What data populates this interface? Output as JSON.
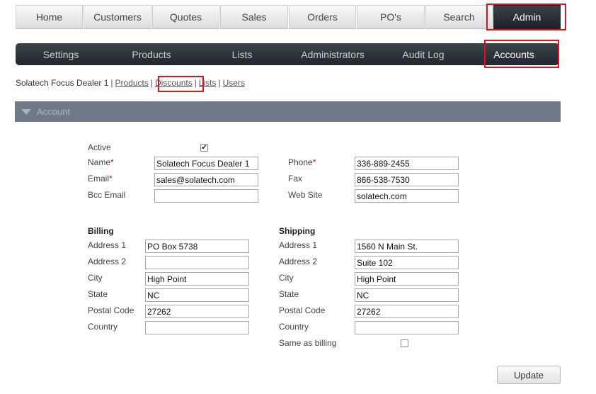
{
  "topnav": {
    "tabs": [
      "Home",
      "Customers",
      "Quotes",
      "Sales",
      "Orders",
      "PO's",
      "Search",
      "Admin"
    ],
    "active": "Admin"
  },
  "subnav": {
    "items": [
      "Settings",
      "Products",
      "Lists",
      "Administrators",
      "Audit Log",
      "Accounts"
    ],
    "active": "Accounts"
  },
  "breadcrumb": {
    "account": "Solatech Focus Dealer 1",
    "links": [
      "Products",
      "Discounts",
      "Lists",
      "Users"
    ],
    "separator": "|"
  },
  "section": {
    "title": "Account"
  },
  "form": {
    "active_label": "Active",
    "active_checked": true,
    "name_label": "Name",
    "name_value": "Solatech Focus Dealer 1",
    "email_label": "Email",
    "email_value": "sales@solatech.com",
    "bcc_label": "Bcc Email",
    "bcc_value": "",
    "phone_label": "Phone",
    "phone_value": "336-889-2455",
    "fax_label": "Fax",
    "fax_value": "866-538-7530",
    "website_label": "Web Site",
    "website_value": "solatech.com",
    "required_mark": "*"
  },
  "billing": {
    "title": "Billing",
    "address1_label": "Address 1",
    "address1": "PO Box 5738",
    "address2_label": "Address 2",
    "address2": "",
    "city_label": "City",
    "city": "High Point",
    "state_label": "State",
    "state": "NC",
    "postal_label": "Postal Code",
    "postal": "27262",
    "country_label": "Country",
    "country": ""
  },
  "shipping": {
    "title": "Shipping",
    "address1_label": "Address 1",
    "address1": "1560 N Main St.",
    "address2_label": "Address 2",
    "address2": "Suite 102",
    "city_label": "City",
    "city": "High Point",
    "state_label": "State",
    "state": "NC",
    "postal_label": "Postal Code",
    "postal": "27262",
    "country_label": "Country",
    "country": "",
    "same_as_billing_label": "Same as billing",
    "same_as_billing_checked": false
  },
  "update_label": "Update",
  "colors": {
    "highlight": "#e3101a",
    "nav_dark": "#1c2228",
    "section_bg": "#707a86"
  },
  "icons": {
    "section_toggle": "triangle-down-icon",
    "check": "checkmark-icon"
  }
}
